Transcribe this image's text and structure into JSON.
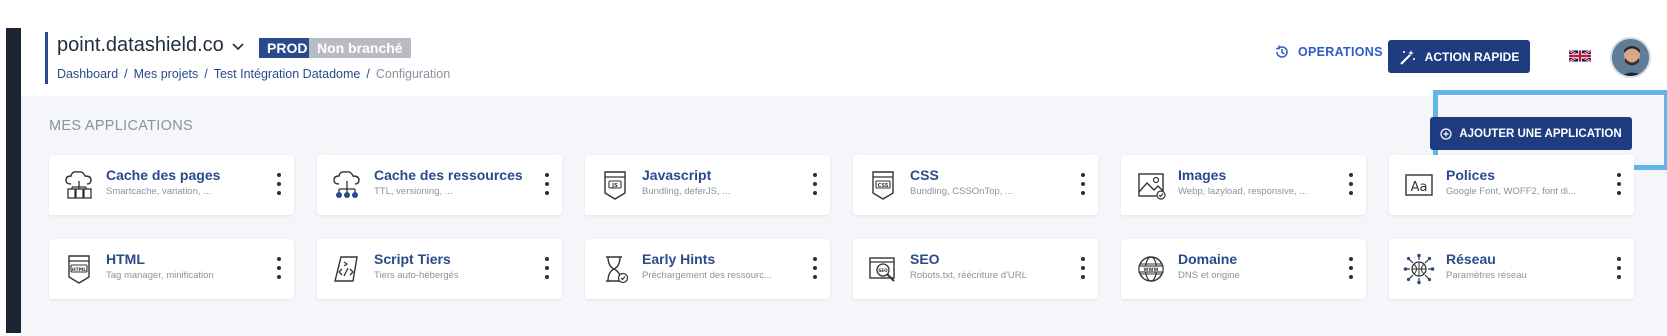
{
  "header": {
    "project_name": "point.datashield.co",
    "env_badge": "PROD",
    "status_badge": "Non branché",
    "breadcrumb": [
      "Dashboard",
      "Mes projets",
      "Test Intégration Datadome",
      "Configuration"
    ],
    "operations_label": "OPERATIONS",
    "action_rapide_label": "ACTION RAPIDE",
    "language_icon": "uk-flag-icon"
  },
  "main": {
    "section_title": "MES APPLICATIONS",
    "add_button_label": "AJOUTER UNE APPLICATION",
    "cards": [
      {
        "title": "Cache des pages",
        "desc": "Smartcache, variation, ...",
        "icon": "cache-pages-icon"
      },
      {
        "title": "Cache des ressources",
        "desc": "TTL, versioning, ...",
        "icon": "cache-resources-icon"
      },
      {
        "title": "Javascript",
        "desc": "Bundling, deferJS, ...",
        "icon": "js-file-icon"
      },
      {
        "title": "CSS",
        "desc": "Bundling, CSSOnTop, ...",
        "icon": "css-file-icon"
      },
      {
        "title": "Images",
        "desc": "Webp, lazyload, responsive, ...",
        "icon": "image-icon"
      },
      {
        "title": "Polices",
        "desc": "Google Font, WOFF2, font di...",
        "icon": "font-icon"
      },
      {
        "title": "HTML",
        "desc": "Tag manager, minification",
        "icon": "html-file-icon"
      },
      {
        "title": "Script Tiers",
        "desc": "Tiers auto-hébergés",
        "icon": "script-icon"
      },
      {
        "title": "Early Hints",
        "desc": "Préchargement des ressourc...",
        "icon": "hourglass-icon"
      },
      {
        "title": "SEO",
        "desc": "Robots.txt, réécriture d'URL",
        "icon": "seo-icon"
      },
      {
        "title": "Domaine",
        "desc": "DNS et origine",
        "icon": "globe-icon"
      },
      {
        "title": "Réseau",
        "desc": "Paramètres réseau",
        "icon": "network-icon"
      }
    ]
  },
  "colors": {
    "primary": "#203c80",
    "link": "#2b4a8c",
    "highlight": "#63b4e8",
    "background": "#f4f6f9"
  }
}
